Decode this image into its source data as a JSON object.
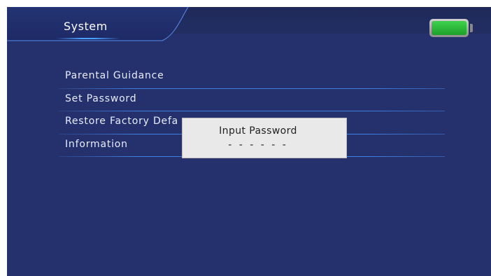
{
  "header": {
    "title": "System",
    "battery_icon": "battery-full-icon",
    "battery_color": "#2ebf3a"
  },
  "menu": {
    "items": [
      {
        "label": "Parental Guidance"
      },
      {
        "label": "Set Password"
      },
      {
        "label": "Restore Factory Defa"
      },
      {
        "label": "Information"
      }
    ]
  },
  "dialog": {
    "title": "Input Password",
    "value": "- - - - - -"
  },
  "colors": {
    "background": "#25316d",
    "accent": "#4aa0ff"
  }
}
